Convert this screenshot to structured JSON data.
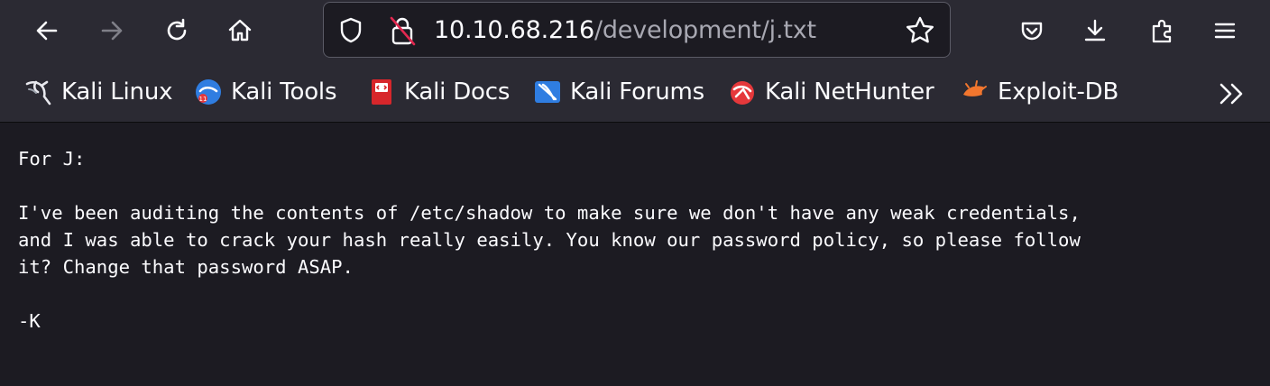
{
  "browser": {
    "url_host": "10.10.68.216",
    "url_path": "/development/j.txt"
  },
  "bookmarks": [
    {
      "label": "Kali Linux",
      "icon": "kali-dragon-icon"
    },
    {
      "label": "Kali Tools",
      "icon": "kali-tools-icon"
    },
    {
      "label": "Kali Docs",
      "icon": "kali-docs-icon"
    },
    {
      "label": "Kali Forums",
      "icon": "kali-forums-icon"
    },
    {
      "label": "Kali NetHunter",
      "icon": "kali-nethunter-icon"
    },
    {
      "label": "Exploit-DB",
      "icon": "exploit-db-icon"
    }
  ],
  "document": {
    "lines": [
      "For J:",
      "",
      "I've been auditing the contents of /etc/shadow to make sure we don't have any weak credentials,",
      "and I was able to crack your hash really easily. You know our password policy, so please follow",
      "it? Change that password ASAP.",
      "",
      "-K"
    ]
  },
  "colors": {
    "toolbar_bg": "#2b2a33",
    "page_bg": "#1c1b22",
    "text": "#fbfbfe",
    "url_path": "#a8a8b2"
  }
}
